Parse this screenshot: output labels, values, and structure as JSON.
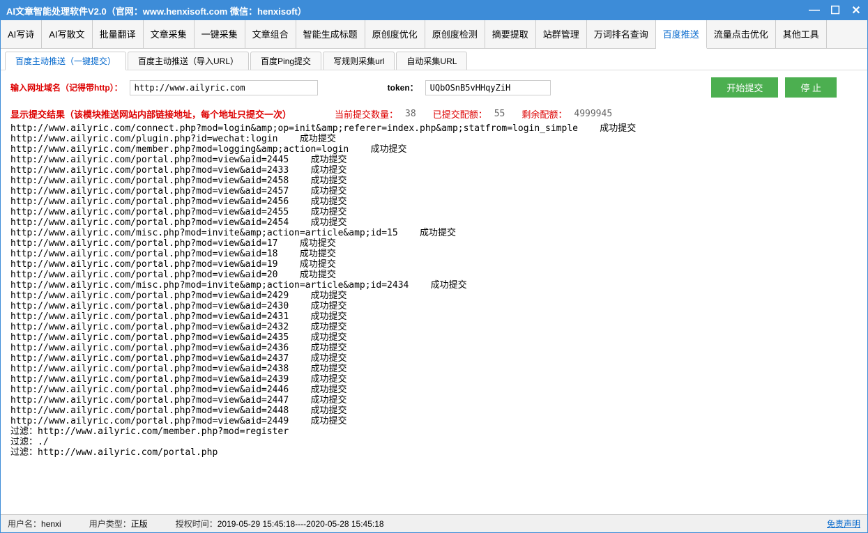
{
  "title": "AI文章智能处理软件V2.0（官网：www.henxisoft.com  微信：henxisoft）",
  "toolbar": [
    "AI写诗",
    "AI写散文",
    "批量翻译",
    "文章采集",
    "一键采集",
    "文章组合",
    "智能生成标题",
    "原创度优化",
    "原创度检测",
    "摘要提取",
    "站群管理",
    "万词排名查询",
    "百度推送",
    "流量点击优化",
    "其他工具"
  ],
  "toolbar_active_index": 12,
  "subtabs": [
    "百度主动推送（一键提交）",
    "百度主动推送（导入URL）",
    "百度Ping提交",
    "写规则采集url",
    "自动采集URL"
  ],
  "subtab_active_index": 0,
  "form": {
    "url_label": "输入网址域名（记得带http）：",
    "url_value": "http://www.ailyric.com",
    "token_label": "token：",
    "token_value": "UQbOSnB5vHHqyZiH",
    "start_btn": "开始提交",
    "stop_btn": "停  止"
  },
  "stats": {
    "result_label": "显示提交结果（该模块推送网站内部链接地址，每个地址只提交一次）",
    "current_label": "当前提交数量：",
    "current_value": "38",
    "committed_label": "已提交配额：",
    "committed_value": "55",
    "remain_label": "剩余配额：",
    "remain_value": "4999945"
  },
  "log_lines": [
    "http://www.ailyric.com/connect.php?mod=login&amp;op=init&amp;referer=index.php&amp;statfrom=login_simple    成功提交",
    "http://www.ailyric.com/plugin.php?id=wechat:login    成功提交",
    "http://www.ailyric.com/member.php?mod=logging&amp;action=login    成功提交",
    "http://www.ailyric.com/portal.php?mod=view&aid=2445    成功提交",
    "http://www.ailyric.com/portal.php?mod=view&aid=2433    成功提交",
    "http://www.ailyric.com/portal.php?mod=view&aid=2458    成功提交",
    "http://www.ailyric.com/portal.php?mod=view&aid=2457    成功提交",
    "http://www.ailyric.com/portal.php?mod=view&aid=2456    成功提交",
    "http://www.ailyric.com/portal.php?mod=view&aid=2455    成功提交",
    "http://www.ailyric.com/portal.php?mod=view&aid=2454    成功提交",
    "http://www.ailyric.com/misc.php?mod=invite&amp;action=article&amp;id=15    成功提交",
    "http://www.ailyric.com/portal.php?mod=view&aid=17    成功提交",
    "http://www.ailyric.com/portal.php?mod=view&aid=18    成功提交",
    "http://www.ailyric.com/portal.php?mod=view&aid=19    成功提交",
    "http://www.ailyric.com/portal.php?mod=view&aid=20    成功提交",
    "http://www.ailyric.com/misc.php?mod=invite&amp;action=article&amp;id=2434    成功提交",
    "http://www.ailyric.com/portal.php?mod=view&aid=2429    成功提交",
    "http://www.ailyric.com/portal.php?mod=view&aid=2430    成功提交",
    "http://www.ailyric.com/portal.php?mod=view&aid=2431    成功提交",
    "http://www.ailyric.com/portal.php?mod=view&aid=2432    成功提交",
    "http://www.ailyric.com/portal.php?mod=view&aid=2435    成功提交",
    "http://www.ailyric.com/portal.php?mod=view&aid=2436    成功提交",
    "http://www.ailyric.com/portal.php?mod=view&aid=2437    成功提交",
    "http://www.ailyric.com/portal.php?mod=view&aid=2438    成功提交",
    "http://www.ailyric.com/portal.php?mod=view&aid=2439    成功提交",
    "http://www.ailyric.com/portal.php?mod=view&aid=2446    成功提交",
    "http://www.ailyric.com/portal.php?mod=view&aid=2447    成功提交",
    "http://www.ailyric.com/portal.php?mod=view&aid=2448    成功提交",
    "http://www.ailyric.com/portal.php?mod=view&aid=2449    成功提交",
    "",
    "过滤：http://www.ailyric.com/member.php?mod=register",
    "过滤：./",
    "过滤：http://www.ailyric.com/portal.php"
  ],
  "statusbar": {
    "user_label": "用户名：",
    "user_value": "henxi",
    "type_label": "用户类型：",
    "type_value": "正版",
    "auth_label": "授权时间：",
    "auth_value": "2019-05-29 15:45:18----2020-05-28 15:45:18",
    "disclaimer": "免责声明"
  }
}
